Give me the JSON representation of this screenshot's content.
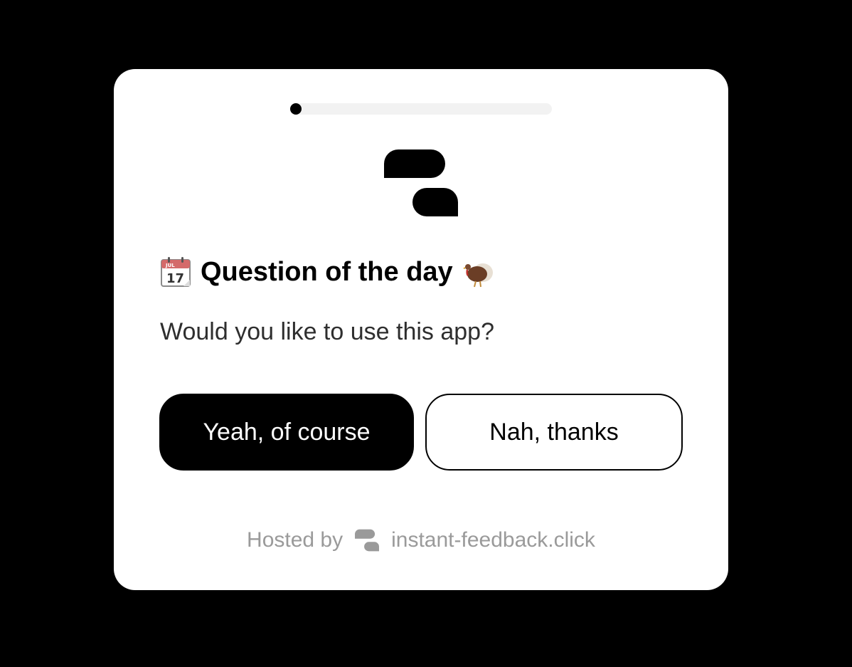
{
  "survey": {
    "progress": 0.0,
    "title": "Question of the day",
    "title_leading_icon": "calendar-icon",
    "title_trailing_icon": "turkey-icon",
    "question": "Would you like to use this app?",
    "options": [
      {
        "label": "Yeah, of course"
      },
      {
        "label": "Nah, thanks"
      }
    ]
  },
  "footer": {
    "hosted_by": "Hosted by",
    "site": "instant-feedback.click"
  },
  "colors": {
    "background": "#000000",
    "card": "#ffffff",
    "primary": "#000000",
    "track": "#f2f2f2",
    "footer_text": "#9a9a9a"
  }
}
